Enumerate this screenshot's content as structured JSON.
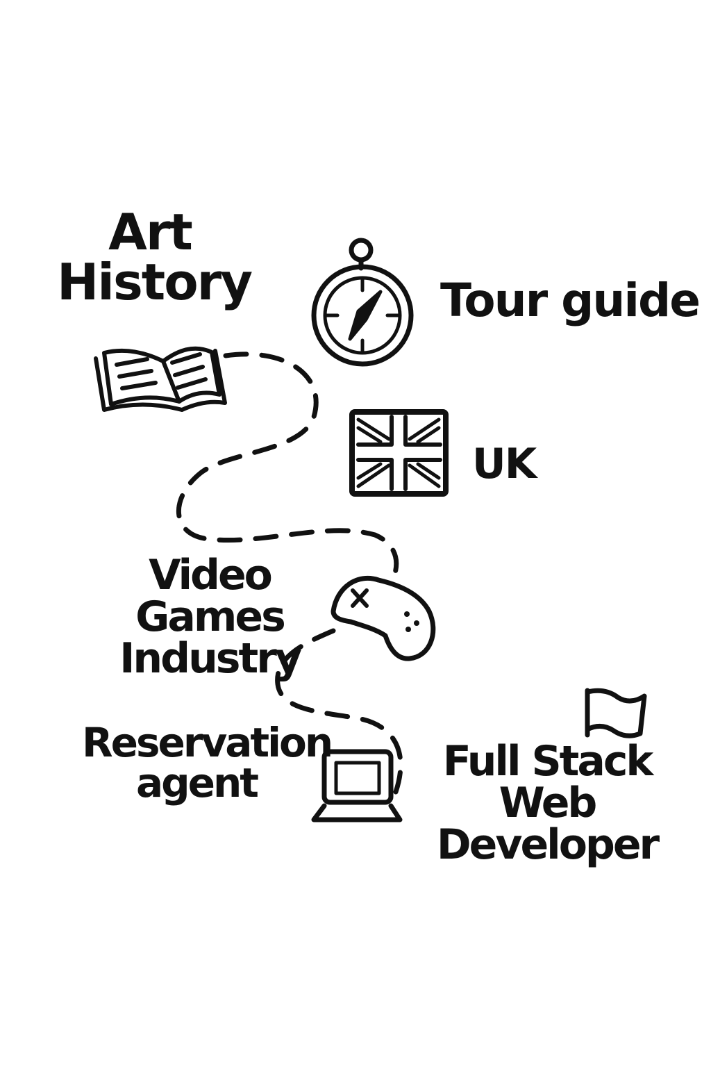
{
  "colors": {
    "ink": "#111111",
    "background": "#ffffff"
  },
  "milestones": [
    {
      "id": "art-history",
      "text": "Art\nHistory",
      "icon": "open-book-icon"
    },
    {
      "id": "tour-guide",
      "text": "Tour guide",
      "icon": "compass-icon"
    },
    {
      "id": "uk",
      "text": "UK",
      "icon": "union-jack-flag-icon"
    },
    {
      "id": "video-games",
      "text": "Video Games\nIndustry",
      "icon": "game-controller-icon"
    },
    {
      "id": "reservation-agent",
      "text": "Reservation\nagent",
      "icon": "laptop-icon"
    },
    {
      "id": "full-stack",
      "text": "Full Stack\nWeb Developer",
      "icon": "finish-flag-icon"
    }
  ],
  "path": {
    "style": "dashed"
  }
}
